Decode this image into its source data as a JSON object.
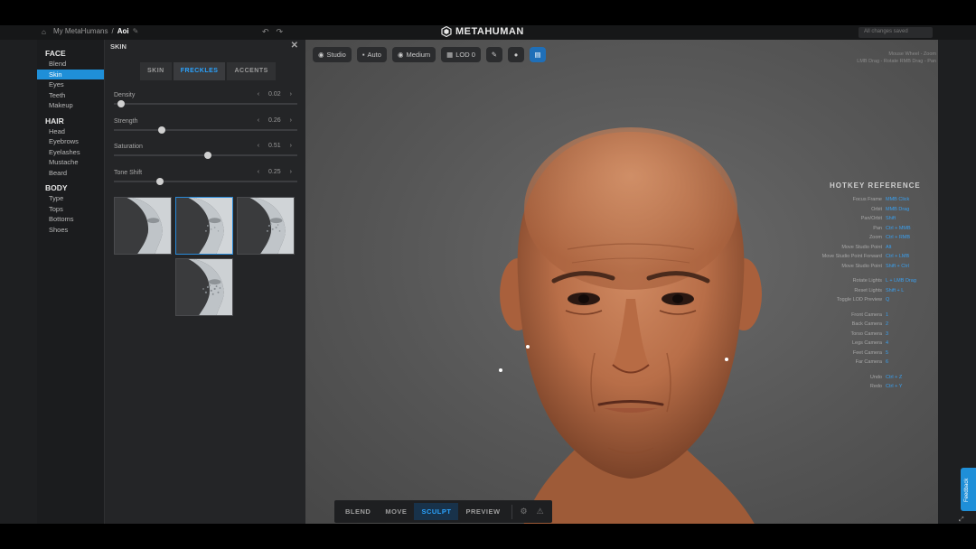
{
  "header": {
    "breadcrumb_root": "My MetaHumans",
    "breadcrumb_sep": "/",
    "breadcrumb_current": "Aoi",
    "brand": "METAHUMAN",
    "search_text": "All changes saved"
  },
  "leftnav": {
    "groups": [
      {
        "title": "FACE",
        "items": [
          "Blend",
          "Skin",
          "Eyes",
          "Teeth",
          "Makeup"
        ],
        "active": 1
      },
      {
        "title": "HAIR",
        "items": [
          "Head",
          "Eyebrows",
          "Eyelashes",
          "Mustache",
          "Beard"
        ]
      },
      {
        "title": "BODY",
        "items": [
          "Type",
          "Tops",
          "Bottoms",
          "Shoes"
        ]
      }
    ]
  },
  "panel": {
    "title": "SKIN",
    "close": "✕",
    "tabs": [
      "SKIN",
      "FRECKLES",
      "ACCENTS"
    ],
    "active_tab": 1,
    "sliders": [
      {
        "label": "Density",
        "value": "0.02",
        "level": 0.04
      },
      {
        "label": "Strength",
        "value": "0.26",
        "level": 0.26
      },
      {
        "label": "Saturation",
        "value": "0.51",
        "level": 0.51
      },
      {
        "label": "Tone Shift",
        "value": "0.25",
        "level": 0.25
      }
    ],
    "prev_arrow": "‹",
    "next_arrow": "›"
  },
  "viewport": {
    "toolbar": {
      "light": "Studio",
      "auto": "Auto",
      "quality": "Medium",
      "lod": "LOD 0"
    },
    "top_right_note": "Mouse Wheel - Zoom\nLMB Drag - Rotate  RMB Drag - Pan"
  },
  "hotkeys": {
    "title": "HOTKEY REFERENCE",
    "rows": [
      {
        "k": "Focus Frame",
        "v": "MMB Click"
      },
      {
        "k": "Orbit",
        "v": "MMB Drag"
      },
      {
        "k": "Pan/Orbit",
        "v": "Shift"
      },
      {
        "k": "Pan",
        "v": "Ctrl + MMB"
      },
      {
        "k": "Zoom",
        "v": "Ctrl + RMB"
      },
      {
        "k": "Move Studio Point",
        "v": "Alt"
      },
      {
        "k": "Move Studio Point Forward",
        "v": "Ctrl + LMB"
      },
      {
        "k": "Move Studio Point",
        "v": "Shift + Ctrl"
      },
      {
        "gap": true
      },
      {
        "k": "Rotate Lights",
        "v": "L + LMB Drag"
      },
      {
        "k": "Reset Lights",
        "v": "Shift + L"
      },
      {
        "k": "Toggle LOD Preview",
        "v": "Q"
      },
      {
        "gap": true
      },
      {
        "k": "Front Camera",
        "v": "1"
      },
      {
        "k": "Back Camera",
        "v": "2"
      },
      {
        "k": "Torso Camera",
        "v": "3"
      },
      {
        "k": "Legs Camera",
        "v": "4"
      },
      {
        "k": "Feet Camera",
        "v": "5"
      },
      {
        "k": "Far Camera",
        "v": "6"
      },
      {
        "gap": true
      },
      {
        "k": "Undo",
        "v": "Ctrl + Z"
      },
      {
        "k": "Redo",
        "v": "Ctrl + Y"
      }
    ]
  },
  "modes": {
    "items": [
      "BLEND",
      "MOVE",
      "SCULPT",
      "PREVIEW"
    ],
    "active": 2
  },
  "feedback": "Feedback",
  "colors": {
    "accent": "#1f8fd8",
    "accent_text": "#2aa3ff",
    "panel_bg": "#242527",
    "viewport_bg": "#5c5c5c"
  }
}
